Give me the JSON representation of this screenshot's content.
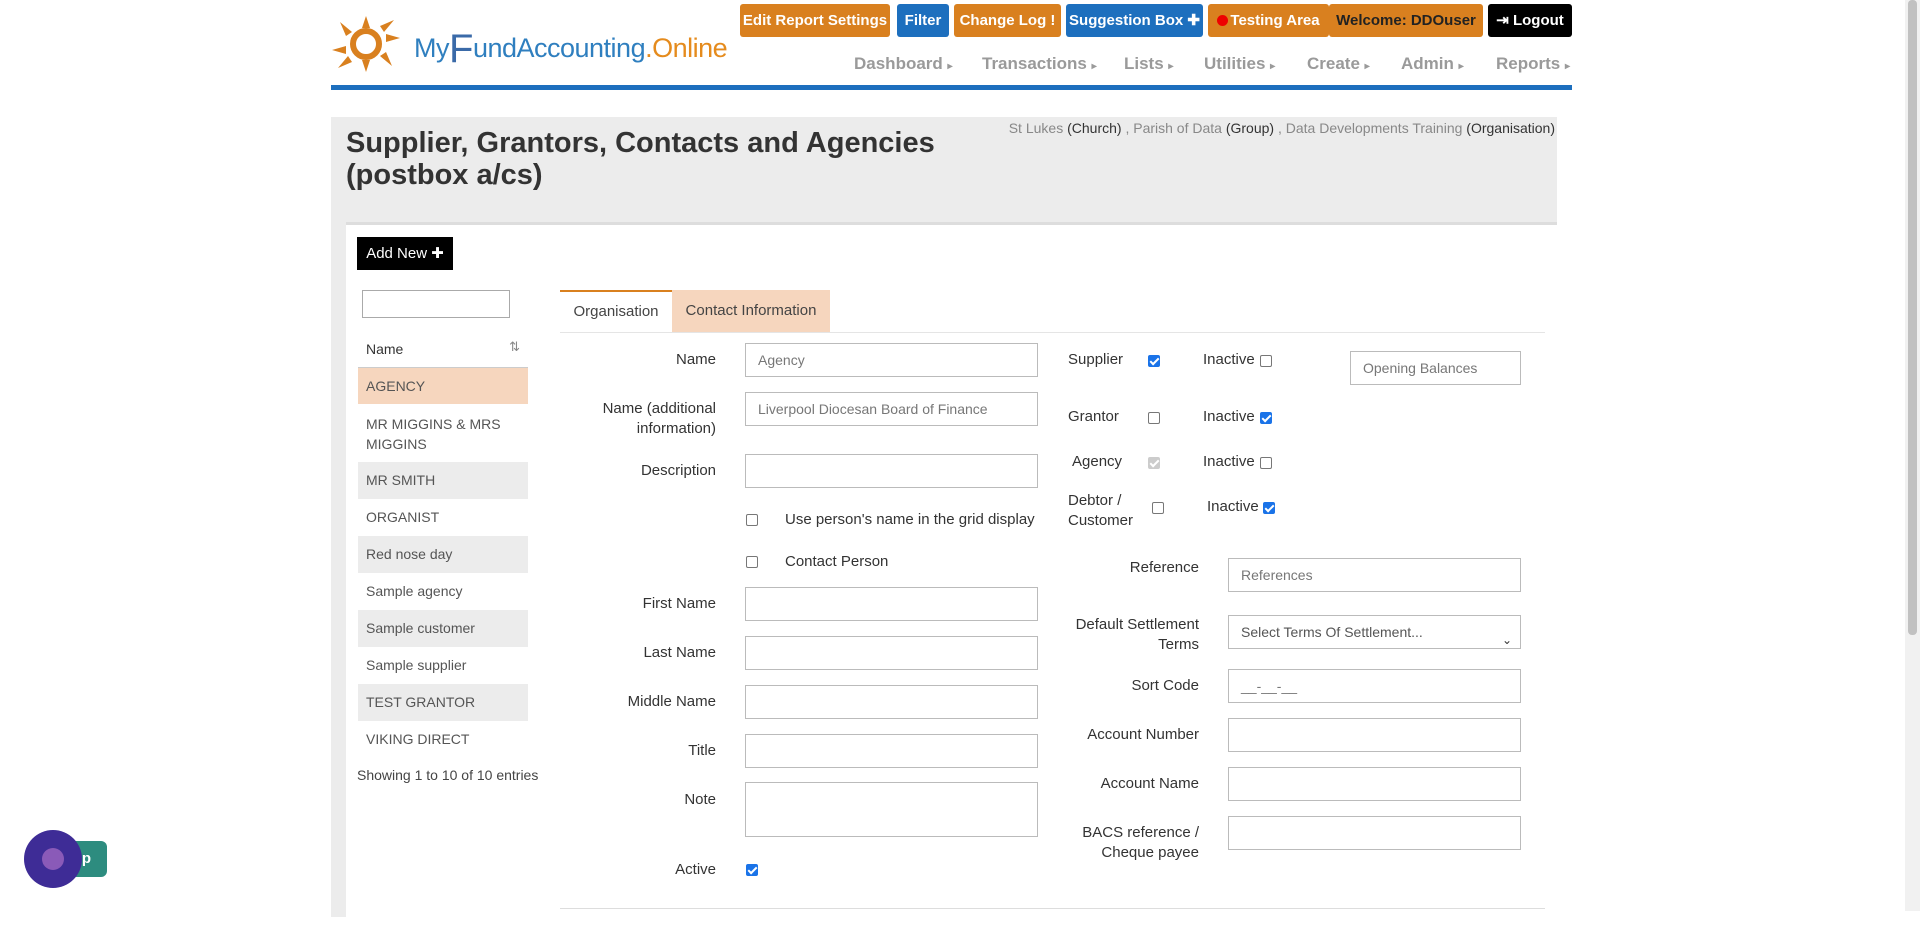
{
  "header": {
    "logo": {
      "part1": "My",
      "part2": "F",
      "part3": "und",
      "part4": "Accounting",
      "part5": ".Online"
    },
    "buttons": {
      "edit_report_settings": "Edit Report Settings",
      "filter": "Filter",
      "change_log": "Change Log !",
      "suggestion_box": "Suggestion Box ✚",
      "testing_area": "Testing Area",
      "welcome": "Welcome:  DDOuser",
      "logout": "Logout"
    },
    "menu": [
      "Dashboard",
      "Transactions",
      "Lists",
      "Utilities",
      "Create",
      "Admin",
      "Reports"
    ]
  },
  "context": {
    "church": "St Lukes",
    "church_tag": "(Church)",
    "group": "Parish of Data",
    "group_tag": "(Group)",
    "org": "Data Developments Training",
    "org_tag": "(Organisation)"
  },
  "page": {
    "title": "Supplier, Grantors, Contacts and Agencies (postbox a/cs)"
  },
  "sidebar": {
    "add_new": "Add New ✚",
    "column_header": "Name",
    "items": [
      "AGENCY",
      "MR MIGGINS & MRS MIGGINS",
      "MR SMITH",
      "ORGANIST",
      "Red nose day",
      "Sample agency",
      "Sample customer",
      "Sample supplier",
      "TEST GRANTOR",
      "VIKING DIRECT"
    ],
    "showing": "Showing 1 to 10 of 10 entries"
  },
  "tabs": {
    "organisation": "Organisation",
    "contact": "Contact Information"
  },
  "form": {
    "name_label": "Name",
    "name_value": "Agency",
    "name_add_label": "Name (additional information)",
    "name_add_value": "Liverpool Diocesan Board of Finance",
    "description_label": "Description",
    "use_person_label": "Use person's name in the grid display",
    "contact_person_label": "Contact Person",
    "first_name_label": "First Name",
    "last_name_label": "Last Name",
    "middle_name_label": "Middle Name",
    "title_label": "Title",
    "note_label": "Note",
    "active_label": "Active",
    "supplier_label": "Supplier",
    "grantor_label": "Grantor",
    "agency_label": "Agency",
    "debtor_label": "Debtor / Customer",
    "inactive_label": "Inactive",
    "opening_balances_placeholder": "Opening Balances",
    "reference_label": "Reference",
    "reference_placeholder": "References",
    "settlement_label": "Default Settlement Terms",
    "settlement_value": "Select Terms Of Settlement...",
    "sort_code_label": "Sort Code",
    "sort_code_placeholder": "__-__-__",
    "account_number_label": "Account Number",
    "account_name_label": "Account Name",
    "bacs_label": "BACS reference / Cheque payee"
  },
  "help": {
    "label": "p"
  },
  "colors": {
    "orange": "#d9801f",
    "blue": "#1d6fbe",
    "selected_row": "#f6d6be",
    "help_purple": "#3e2c96"
  }
}
